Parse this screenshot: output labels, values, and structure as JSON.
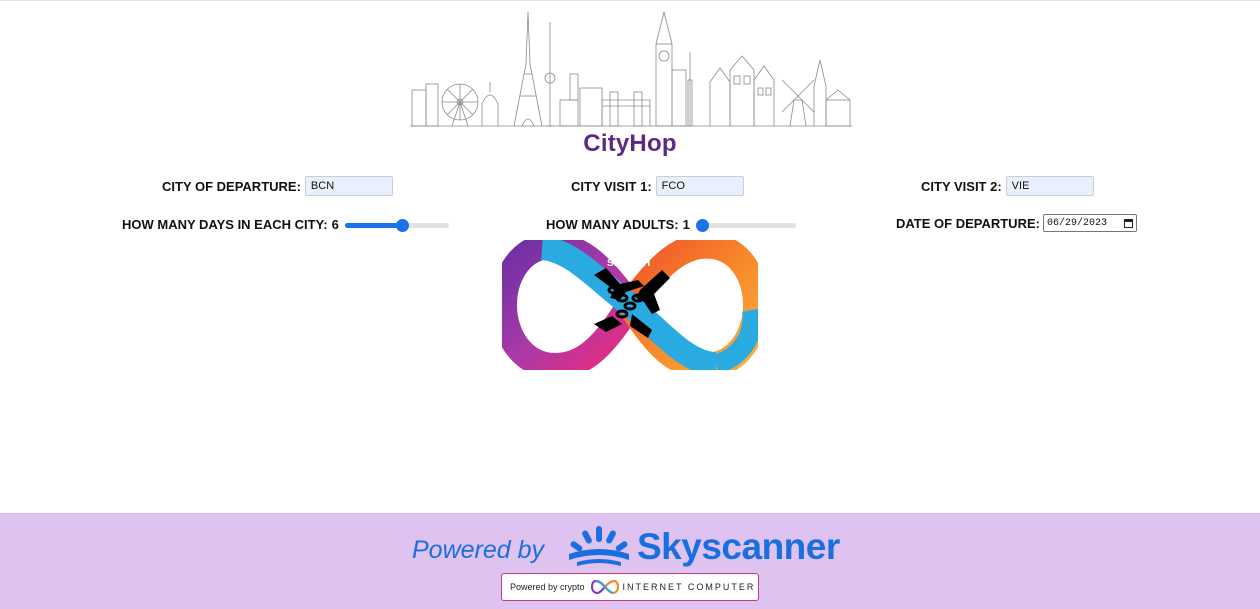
{
  "app": {
    "title": "CityHop"
  },
  "form": {
    "departure": {
      "label": "CITY OF DEPARTURE:",
      "value": "BCN"
    },
    "visit1": {
      "label": "CITY VISIT 1:",
      "value": "FCO"
    },
    "visit2": {
      "label": "CITY VISIT 2:",
      "value": "VIE"
    },
    "days": {
      "label": "HOW MANY DAYS IN EACH CITY:",
      "value": "6",
      "fraction": 0.55
    },
    "adults": {
      "label": "HOW MANY ADULTS:",
      "value": "1",
      "fraction": 0.0
    },
    "date": {
      "label": "DATE OF DEPARTURE:",
      "value": "06/29/2023"
    }
  },
  "search": {
    "label": "SEARCH"
  },
  "footer": {
    "powered_by": "Powered by",
    "brand": "Skyscanner",
    "badge_prefix": "Powered by crypto",
    "badge_name": "INTERNET COMPUTER"
  },
  "colors": {
    "title": "#5b2a86",
    "accent": "#1a73e8",
    "footer_bg": "#dec2f0",
    "skyscanner_blue": "#1a6fe0"
  }
}
